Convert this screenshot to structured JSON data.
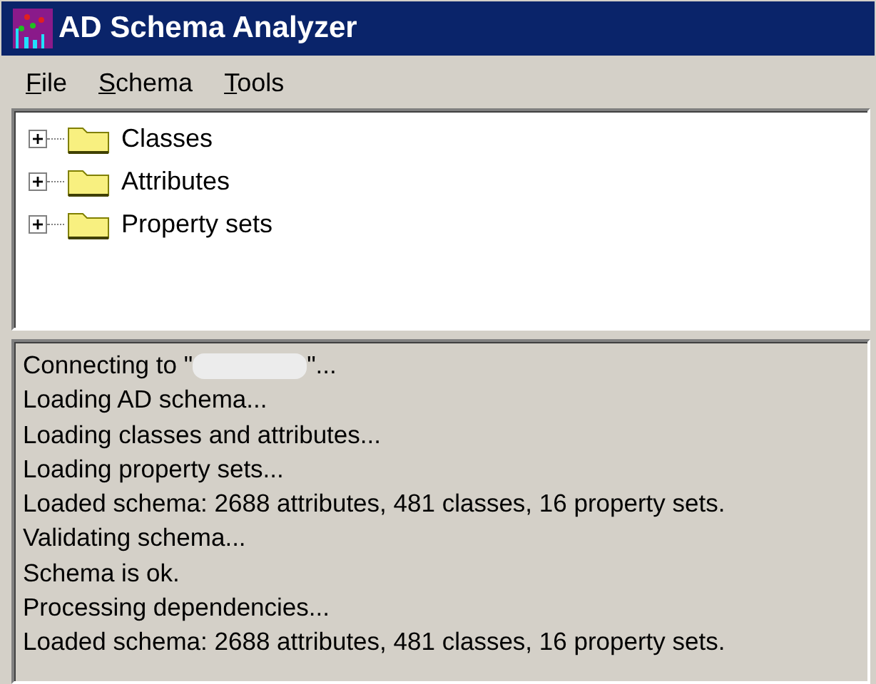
{
  "window": {
    "title": "AD Schema Analyzer"
  },
  "menu": [
    {
      "label": "File"
    },
    {
      "label": "Schema"
    },
    {
      "label": "Tools"
    }
  ],
  "tree": {
    "items": [
      {
        "label": "Classes",
        "expanded": false
      },
      {
        "label": "Attributes",
        "expanded": false
      },
      {
        "label": "Property sets",
        "expanded": false
      }
    ]
  },
  "log": {
    "lines": [
      {
        "kind": "redacted",
        "before": "Connecting to \"",
        "after": "\"..."
      },
      {
        "kind": "text",
        "text": "Loading AD schema..."
      },
      {
        "kind": "text",
        "text": "Loading classes and attributes..."
      },
      {
        "kind": "text",
        "text": "Loading property sets..."
      },
      {
        "kind": "text",
        "text": "Loaded schema: 2688 attributes, 481 classes, 16 property sets."
      },
      {
        "kind": "text",
        "text": "Validating schema..."
      },
      {
        "kind": "text",
        "text": "Schema is ok."
      },
      {
        "kind": "text",
        "text": "Processing dependencies..."
      },
      {
        "kind": "text",
        "text": "Loaded schema: 2688 attributes, 481 classes, 16 property sets."
      }
    ]
  }
}
